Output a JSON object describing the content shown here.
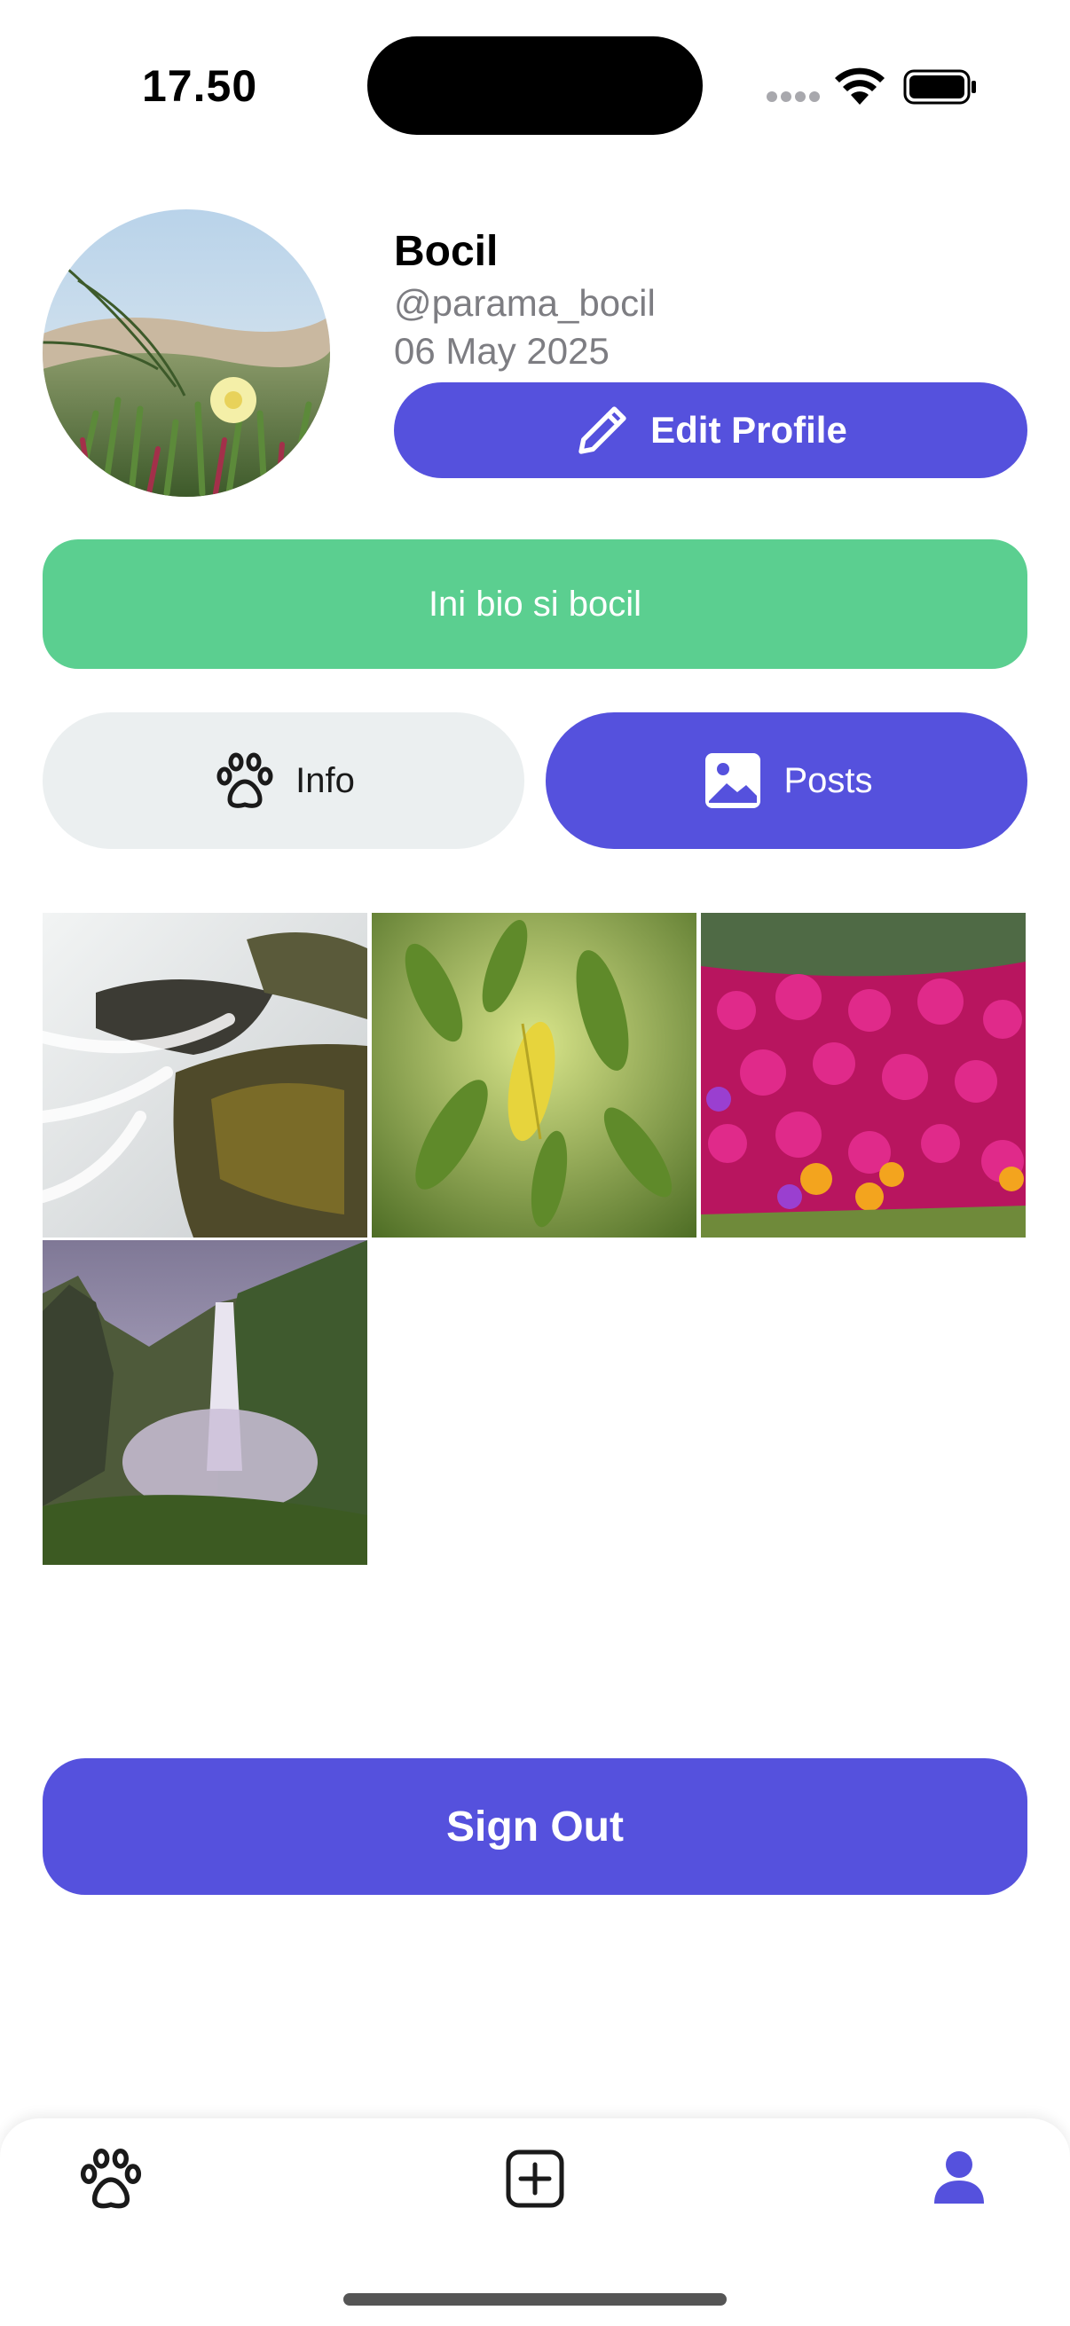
{
  "status_bar": {
    "time": "17.50"
  },
  "profile": {
    "name": "Bocil",
    "handle": "@parama_bocil",
    "joined": "06 May 2025",
    "edit_label": "Edit Profile",
    "bio": "Ini bio si bocil"
  },
  "tabs": {
    "info_label": "Info",
    "posts_label": "Posts",
    "active": "posts"
  },
  "posts": [
    {
      "subject": "waterfall over mossy rocks"
    },
    {
      "subject": "green leaves with yellow leaf"
    },
    {
      "subject": "magenta ice plant flowers"
    },
    {
      "subject": "misty waterfall canyon"
    }
  ],
  "sign_out_label": "Sign Out",
  "tab_bar": {
    "items": [
      "paw-icon",
      "add-post-icon",
      "profile-icon"
    ],
    "active": "profile"
  },
  "colors": {
    "accent": "#5551dd",
    "bio_background": "#5bcf90",
    "inactive_tab": "#ebeff0",
    "secondary_text": "#7d7d82"
  }
}
